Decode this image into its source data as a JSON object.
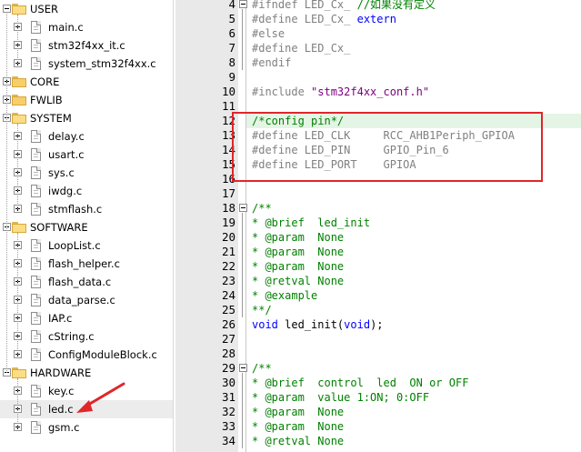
{
  "project_tree": {
    "items": [
      {
        "label": "USER",
        "type": "group",
        "expanded": true
      },
      {
        "label": "main.c",
        "type": "file",
        "expandable": true
      },
      {
        "label": "stm32f4xx_it.c",
        "type": "file",
        "expandable": true
      },
      {
        "label": "system_stm32f4xx.c",
        "type": "file",
        "expandable": true
      },
      {
        "label": "CORE",
        "type": "group",
        "expanded": false
      },
      {
        "label": "FWLIB",
        "type": "group",
        "expanded": false
      },
      {
        "label": "SYSTEM",
        "type": "group",
        "expanded": true
      },
      {
        "label": "delay.c",
        "type": "file",
        "expandable": true
      },
      {
        "label": "usart.c",
        "type": "file",
        "expandable": true
      },
      {
        "label": "sys.c",
        "type": "file",
        "expandable": true
      },
      {
        "label": "iwdg.c",
        "type": "file",
        "expandable": true
      },
      {
        "label": "stmflash.c",
        "type": "file",
        "expandable": true
      },
      {
        "label": "SOFTWARE",
        "type": "group",
        "expanded": true
      },
      {
        "label": "LoopList.c",
        "type": "file",
        "expandable": true
      },
      {
        "label": "flash_helper.c",
        "type": "file",
        "expandable": true
      },
      {
        "label": "flash_data.c",
        "type": "file",
        "expandable": true
      },
      {
        "label": "data_parse.c",
        "type": "file",
        "expandable": true
      },
      {
        "label": "IAP.c",
        "type": "file",
        "expandable": true
      },
      {
        "label": "cString.c",
        "type": "file",
        "expandable": true
      },
      {
        "label": "ConfigModuleBlock.c",
        "type": "file",
        "expandable": true
      },
      {
        "label": "HARDWARE",
        "type": "group",
        "expanded": true
      },
      {
        "label": "key.c",
        "type": "file",
        "expandable": true
      },
      {
        "label": "led.c",
        "type": "file",
        "expandable": true,
        "selected": true
      },
      {
        "label": "gsm.c",
        "type": "file",
        "expandable": true
      }
    ]
  },
  "editor": {
    "lines": [
      {
        "num": "4",
        "segments": [
          {
            "t": "#ifndef LED_Cx_",
            "c": "pre"
          },
          {
            "t": " //如果没有定义",
            "c": "green"
          }
        ],
        "fold": true
      },
      {
        "num": "5",
        "segments": [
          {
            "t": "#define LED_Cx_ ",
            "c": "pre"
          },
          {
            "t": "extern",
            "c": "kw"
          }
        ]
      },
      {
        "num": "6",
        "segments": [
          {
            "t": "#else",
            "c": "pre"
          }
        ]
      },
      {
        "num": "7",
        "segments": [
          {
            "t": "#define LED_Cx_",
            "c": "pre"
          }
        ]
      },
      {
        "num": "8",
        "segments": [
          {
            "t": "#endif",
            "c": "pre"
          }
        ]
      },
      {
        "num": "9",
        "segments": []
      },
      {
        "num": "10",
        "segments": [
          {
            "t": "#include ",
            "c": "pre"
          },
          {
            "t": "\"stm32f4xx_conf.h\"",
            "c": "str"
          }
        ]
      },
      {
        "num": "11",
        "segments": []
      },
      {
        "num": "12",
        "segments": [
          {
            "t": "/*config pin*/",
            "c": "green"
          }
        ],
        "highlighted": true
      },
      {
        "num": "13",
        "segments": [
          {
            "t": "#define LED_CLK     RCC_AHB1Periph_GPIOA",
            "c": "pre"
          }
        ]
      },
      {
        "num": "14",
        "segments": [
          {
            "t": "#define LED_PIN     GPIO_Pin_6",
            "c": "pre"
          }
        ]
      },
      {
        "num": "15",
        "segments": [
          {
            "t": "#define LED_PORT    GPIOA",
            "c": "pre"
          }
        ]
      },
      {
        "num": "16",
        "segments": []
      },
      {
        "num": "17",
        "segments": []
      },
      {
        "num": "18",
        "segments": [
          {
            "t": "/**",
            "c": "green"
          }
        ],
        "fold": true
      },
      {
        "num": "19",
        "segments": [
          {
            "t": "* @brief  led_init",
            "c": "green"
          }
        ]
      },
      {
        "num": "20",
        "segments": [
          {
            "t": "* @param  None",
            "c": "green"
          }
        ]
      },
      {
        "num": "21",
        "segments": [
          {
            "t": "* @param  None",
            "c": "green"
          }
        ]
      },
      {
        "num": "22",
        "segments": [
          {
            "t": "* @param  None",
            "c": "green"
          }
        ]
      },
      {
        "num": "23",
        "segments": [
          {
            "t": "* @retval None",
            "c": "green"
          }
        ]
      },
      {
        "num": "24",
        "segments": [
          {
            "t": "* @example",
            "c": "green"
          }
        ]
      },
      {
        "num": "25",
        "segments": [
          {
            "t": "**/",
            "c": "green"
          }
        ]
      },
      {
        "num": "26",
        "segments": [
          {
            "t": "void",
            "c": "kw"
          },
          {
            "t": " led_init(",
            "c": "plain"
          },
          {
            "t": "void",
            "c": "kw"
          },
          {
            "t": ");",
            "c": "plain"
          }
        ]
      },
      {
        "num": "27",
        "segments": []
      },
      {
        "num": "28",
        "segments": []
      },
      {
        "num": "29",
        "segments": [
          {
            "t": "/**",
            "c": "green"
          }
        ],
        "fold": true
      },
      {
        "num": "30",
        "segments": [
          {
            "t": "* @brief  control  led  ON or OFF",
            "c": "green"
          }
        ]
      },
      {
        "num": "31",
        "segments": [
          {
            "t": "* @param  value 1:ON; 0:OFF",
            "c": "green"
          }
        ]
      },
      {
        "num": "32",
        "segments": [
          {
            "t": "* @param  None",
            "c": "green"
          }
        ]
      },
      {
        "num": "33",
        "segments": [
          {
            "t": "* @param  None",
            "c": "green"
          }
        ]
      },
      {
        "num": "34",
        "segments": [
          {
            "t": "* @retval None",
            "c": "green"
          }
        ]
      }
    ]
  },
  "annotations": {
    "highlight_box_color": "#e0262a",
    "arrow_color": "#e0262a",
    "arrow_target": "led.c"
  }
}
